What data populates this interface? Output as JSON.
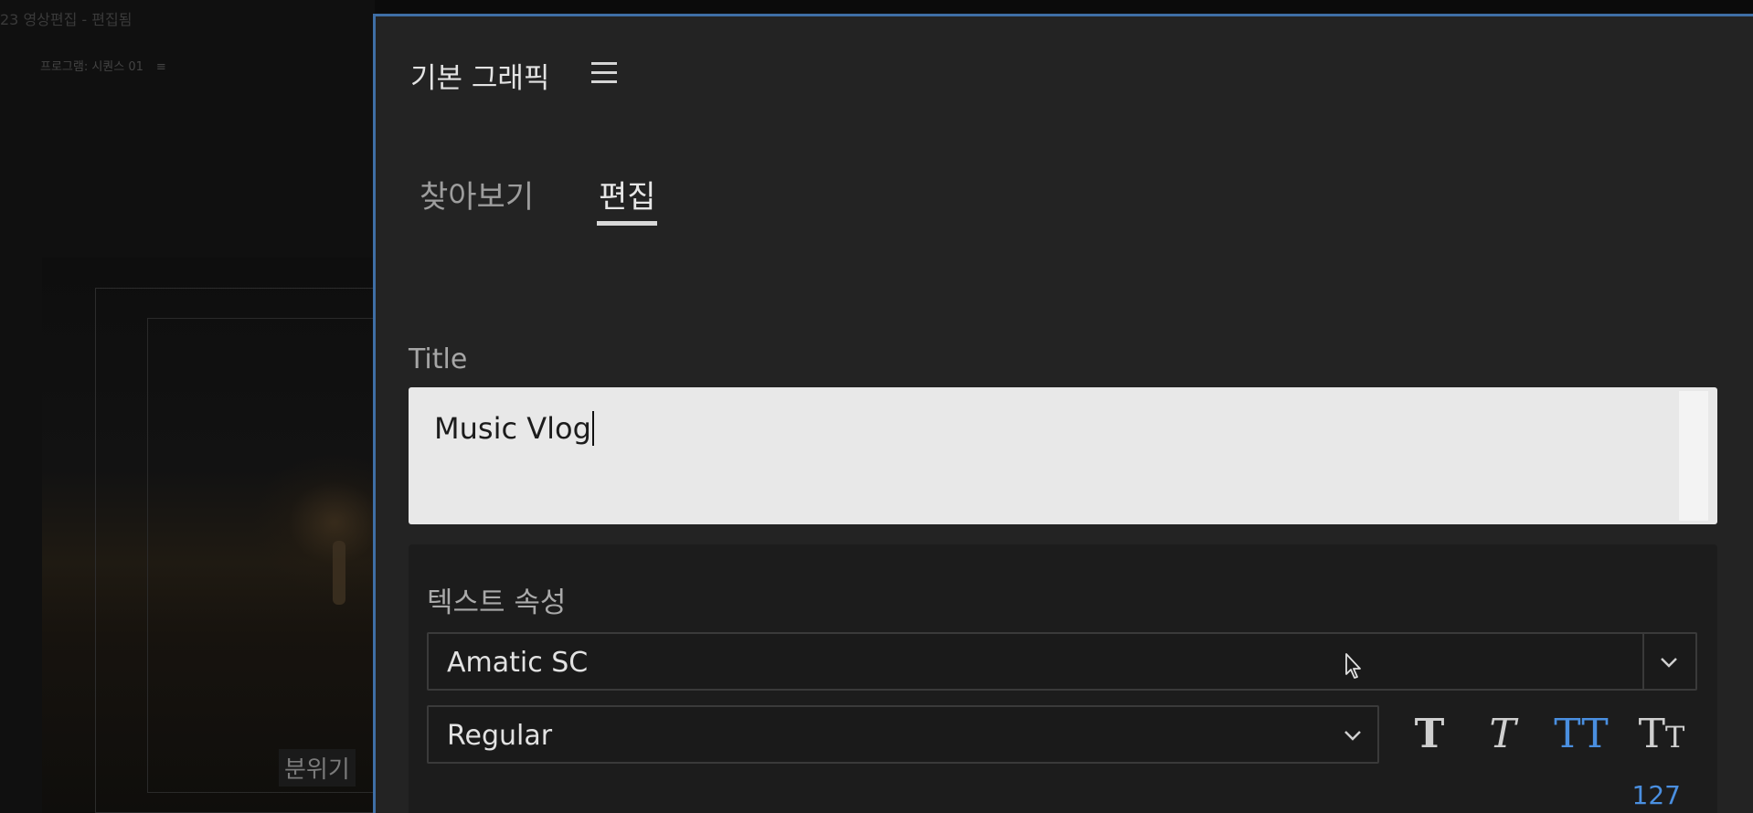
{
  "background": {
    "window_title": "23 영상편집 - 편집됨",
    "program_tab": "프로그램: 시퀀스 01",
    "video_caption": "분위기"
  },
  "panel": {
    "title": "기본 그래픽",
    "menu_icon": "hamburger-icon",
    "tabs": [
      {
        "label": "찾아보기",
        "active": false
      },
      {
        "label": "편집",
        "active": true
      }
    ],
    "title_field": {
      "label": "Title",
      "value": "Music Vlog"
    },
    "text_properties": {
      "header": "텍스트 속성",
      "font_family": "Amatic SC",
      "font_style": "Regular",
      "format_buttons": [
        "bold-T",
        "italic-T",
        "all-caps-TT",
        "small-caps-Tt"
      ],
      "active_format": "all-caps",
      "kerning_value": "127"
    }
  },
  "colors": {
    "panel_bg": "#232323",
    "accent_blue": "#4a8fe0",
    "panel_border": "#3f6fa6"
  }
}
